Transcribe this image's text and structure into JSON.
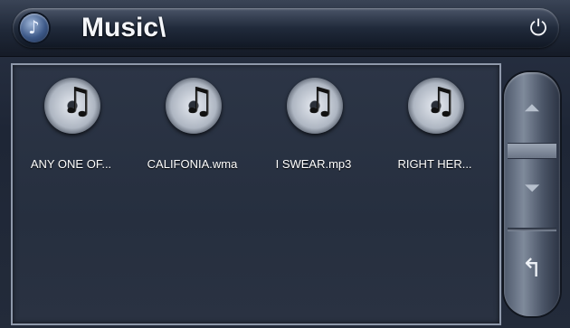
{
  "header": {
    "title": "Music\\",
    "home_icon": "music-note-icon",
    "power_icon": "power-icon",
    "power_glyph": "⏻",
    "home_glyph": "♪"
  },
  "files": [
    {
      "label": "ANY ONE OF...",
      "icon": "music-file-icon"
    },
    {
      "label": "CALIFONIA.wma",
      "icon": "music-file-icon"
    },
    {
      "label": "I SWEAR.mp3",
      "icon": "music-file-icon"
    },
    {
      "label": "RIGHT HER...",
      "icon": "music-file-icon"
    }
  ],
  "sidebar": {
    "scroll_up_glyph": "⏶",
    "scroll_down_glyph": "⏷",
    "back_glyph": "↰"
  }
}
